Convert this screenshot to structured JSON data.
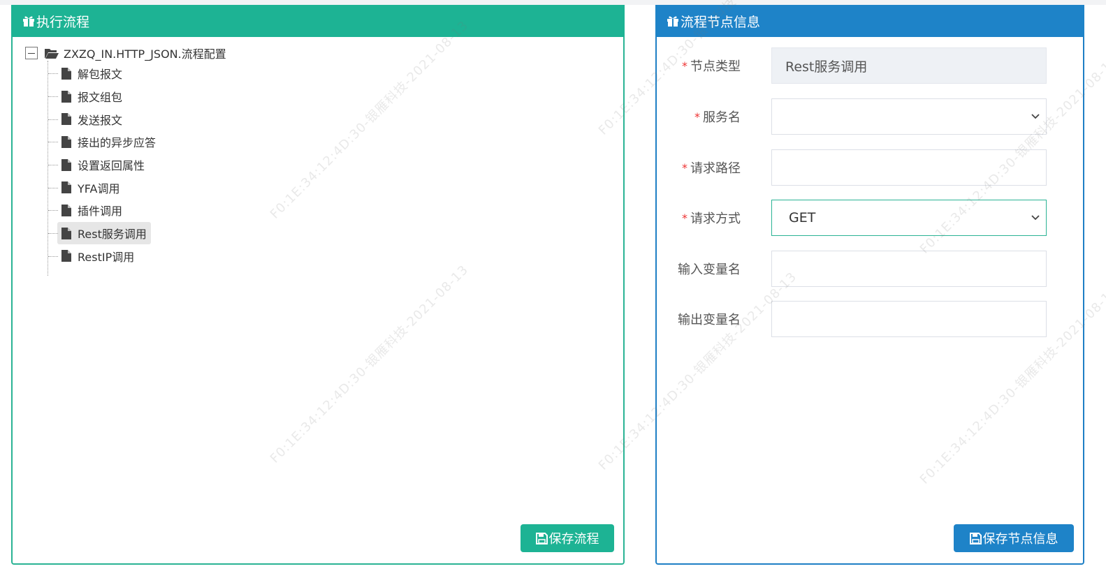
{
  "left_panel": {
    "title": "执行流程",
    "tree": {
      "root_label": "ZXZQ_IN.HTTP_JSON.流程配置",
      "items": [
        {
          "label": "解包报文"
        },
        {
          "label": "报文组包"
        },
        {
          "label": "发送报文"
        },
        {
          "label": "接出的异步应答"
        },
        {
          "label": "设置返回属性"
        },
        {
          "label": "YFA调用"
        },
        {
          "label": "插件调用"
        },
        {
          "label": "Rest服务调用",
          "selected": true
        },
        {
          "label": "RestIP调用"
        }
      ]
    },
    "save_button": "保存流程"
  },
  "right_panel": {
    "title": "流程节点信息",
    "fields": {
      "node_type": {
        "label": "节点类型",
        "required": "*",
        "value": "Rest服务调用"
      },
      "service_name": {
        "label": "服务名",
        "required": "*",
        "value": ""
      },
      "request_path": {
        "label": "请求路径",
        "required": "*",
        "value": ""
      },
      "request_method": {
        "label": "请求方式",
        "required": "*",
        "value": "GET"
      },
      "input_var": {
        "label": "输入变量名",
        "value": ""
      },
      "output_var": {
        "label": "输出变量名",
        "value": ""
      }
    },
    "save_button": "保存节点信息"
  },
  "watermark": "F0:1E:34:12:4D:30-银雁科技-2021-08-13",
  "colors": {
    "green": "#1db394",
    "blue": "#1e83c8",
    "required": "#ee3333"
  },
  "icons": {
    "header": "gift-icon",
    "folder": "folder-open-icon",
    "file": "file-icon",
    "save": "floppy-disk-icon",
    "dropdown": "chevron-down-icon"
  }
}
